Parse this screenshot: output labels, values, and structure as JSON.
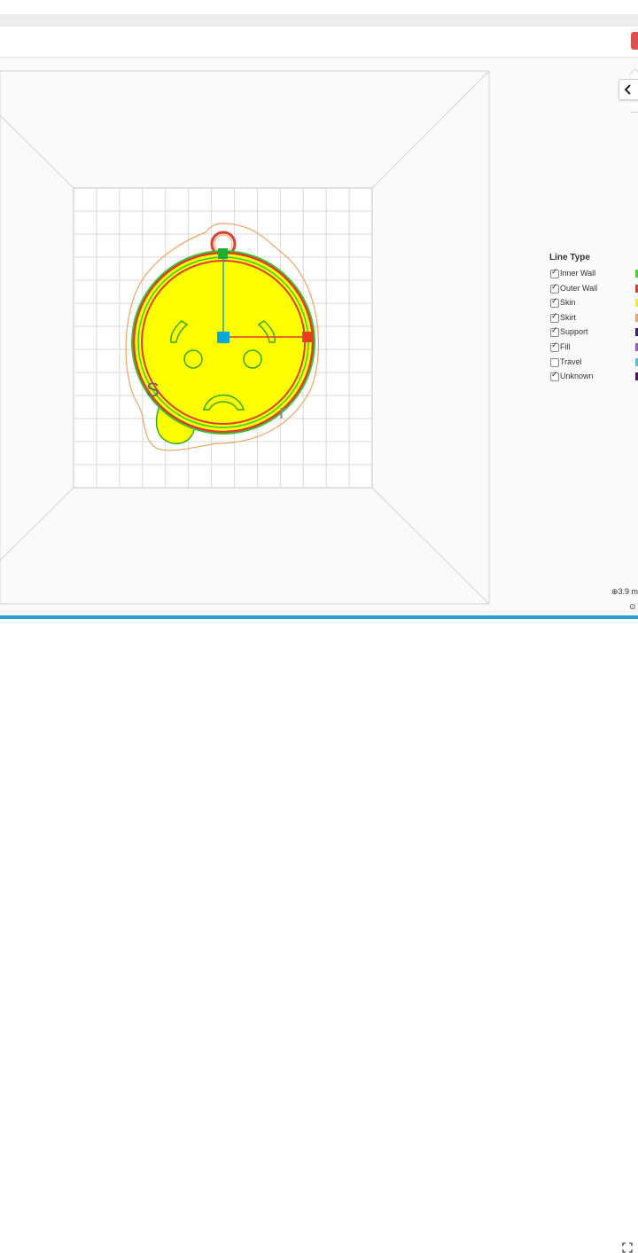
{
  "legend": {
    "title": "Line Type",
    "items": [
      {
        "label": "Inner Wall",
        "checked": true,
        "color": "#33dd33"
      },
      {
        "label": "Outer Wall",
        "checked": true,
        "color": "#e03c31"
      },
      {
        "label": "Skin",
        "checked": true,
        "color": "#f5ee1a"
      },
      {
        "label": "Skirt",
        "checked": true,
        "color": "#f2a35e"
      },
      {
        "label": "Support",
        "checked": true,
        "color": "#4b1d70"
      },
      {
        "label": "Fill",
        "checked": true,
        "color": "#9b59d0"
      },
      {
        "label": "Travel",
        "checked": false,
        "color": "#4fc3e3"
      },
      {
        "label": "Unknown",
        "checked": true,
        "color": "#5a0f6e"
      }
    ]
  },
  "stats": {
    "size_text": "3.9 m",
    "icon": "clock-icon",
    "nav_icon": "chevron-left-icon"
  },
  "theme": {
    "progress_color": "#2a9fd6",
    "close_color": "#d9534f",
    "model_fill": "#ffff00",
    "outer_wall": "#e03c31",
    "inner_wall": "#33dd33",
    "skirt": "#f2a35e"
  }
}
